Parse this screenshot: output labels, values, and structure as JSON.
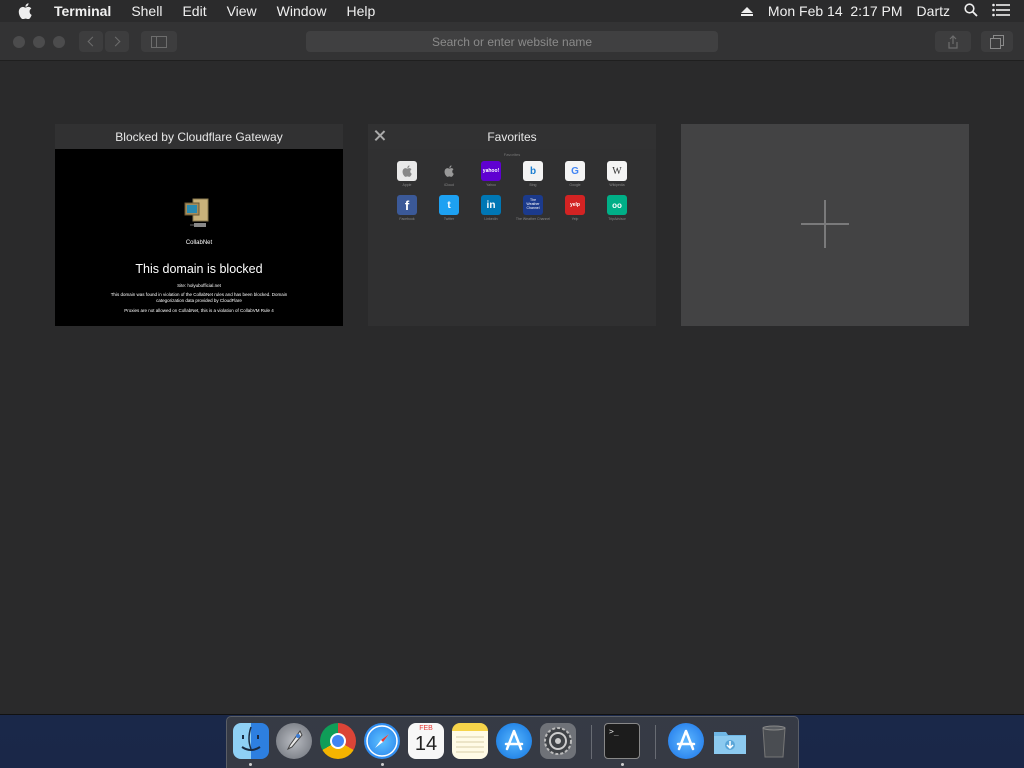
{
  "menubar": {
    "app_name": "Terminal",
    "items": [
      "Shell",
      "Edit",
      "View",
      "Window",
      "Help"
    ],
    "datetime": "Mon Feb 14  2:17 PM",
    "user": "Dartz"
  },
  "browser": {
    "address_placeholder": "Search or enter website name",
    "tabs": [
      {
        "title": "Blocked by Cloudflare Gateway",
        "logo_label": "CollabNet",
        "heading": "This domain is blocked",
        "site": "Site: holyubofficial.net",
        "message": "This domain was found in violation of the CollabNet rules and has been blocked. Domain categorization data provided by CloudFlare",
        "footer": "Proxies are not allowed on CollabNet, this is a violation of CollabVM Rule 4"
      },
      {
        "title": "Favorites",
        "section_label": "Favorites",
        "favorites": [
          {
            "label": "Apple",
            "glyph": ""
          },
          {
            "label": "iCloud",
            "glyph": ""
          },
          {
            "label": "Yahoo",
            "glyph": "yahoo!"
          },
          {
            "label": "Bing",
            "glyph": "b"
          },
          {
            "label": "Google",
            "glyph": "G"
          },
          {
            "label": "Wikipedia",
            "glyph": "W"
          },
          {
            "label": "Facebook",
            "glyph": "f"
          },
          {
            "label": "Twitter",
            "glyph": "t"
          },
          {
            "label": "LinkedIn",
            "glyph": "in"
          },
          {
            "label": "The Weather Channel",
            "glyph": "The Weather Channel"
          },
          {
            "label": "Yelp",
            "glyph": "yelp"
          },
          {
            "label": "TripAdvisor",
            "glyph": "oo"
          }
        ]
      }
    ]
  },
  "dock": {
    "calendar_month": "FEB",
    "calendar_day": "14",
    "apps": [
      "Finder",
      "Launchpad",
      "Chrome",
      "Safari",
      "Calendar",
      "Notes",
      "App Store",
      "System Preferences",
      "Terminal",
      "Applications",
      "Downloads",
      "Trash"
    ]
  },
  "colors": {
    "window_bg": "#2a2a2b",
    "toolbar_bg": "#333334",
    "twitter": "#1da1f2",
    "facebook": "#3b5998",
    "linkedin": "#0077b5",
    "yahoo": "#5f01d1"
  }
}
